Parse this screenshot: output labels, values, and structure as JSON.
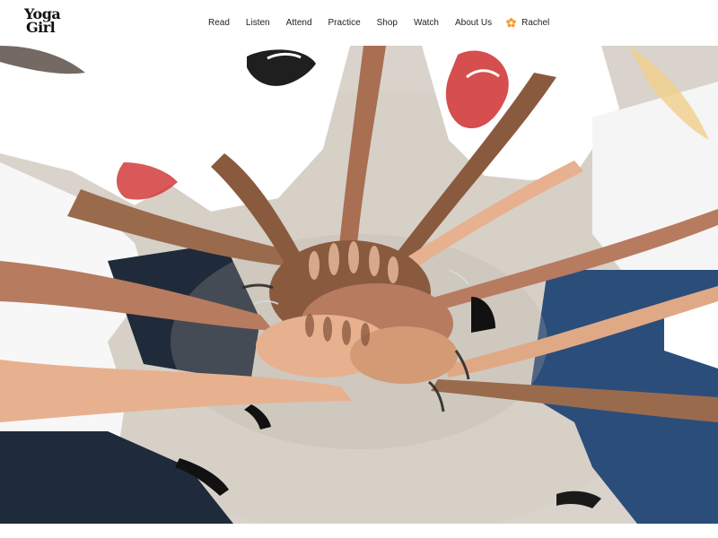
{
  "header": {
    "logo": {
      "line1": "Yoga",
      "line2": "Girl"
    },
    "nav": [
      {
        "label": "Read"
      },
      {
        "label": "Listen"
      },
      {
        "label": "Attend"
      },
      {
        "label": "Practice"
      },
      {
        "label": "Shop"
      },
      {
        "label": "Watch"
      },
      {
        "label": "About Us"
      }
    ],
    "user": {
      "name": "Rachel",
      "icon": "flower-icon",
      "icon_color": "#f39c32"
    }
  },
  "hero": {
    "image_subject": "group-hands-stacked-photo",
    "colors": {
      "ground": "#d9d3cb",
      "shirt": "#ffffff",
      "logo_red": "#d23b3b",
      "logo_black": "#1f1f1f",
      "skin_dark": "#8a5a3f",
      "skin_mid": "#b77b5f",
      "skin_light": "#e7b190",
      "denim": "#2b4d7a",
      "dark_pants": "#1f2a3a"
    }
  }
}
